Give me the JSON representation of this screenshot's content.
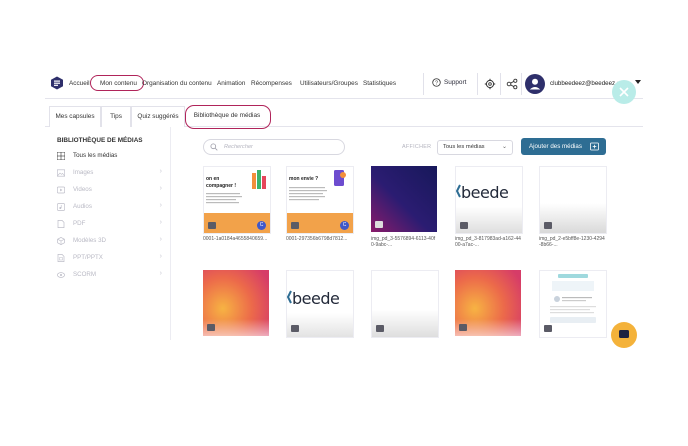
{
  "nav": {
    "items": [
      "Accueil",
      "Mon contenu",
      "Organisation du contenu",
      "Animation",
      "Récompenses",
      "Utilisateurs/Groupes",
      "Statistiques"
    ],
    "support": "Support",
    "username": "clubbeedeez@beedeez.c"
  },
  "tabs": [
    "Mes capsules",
    "Tips",
    "Quiz suggérés",
    "Bibliothèque de médias"
  ],
  "sidebar": {
    "title": "BIBLIOTHÈQUE DE MÉDIAS",
    "items": [
      {
        "label": "Tous les médias",
        "icon": "grid-icon"
      },
      {
        "label": "Images",
        "icon": "image-icon"
      },
      {
        "label": "Videos",
        "icon": "video-icon"
      },
      {
        "label": "Audios",
        "icon": "audio-icon"
      },
      {
        "label": "PDF",
        "icon": "pdf-icon"
      },
      {
        "label": "Modèles 3D",
        "icon": "cube-icon"
      },
      {
        "label": "PPT/PPTX",
        "icon": "presentation-icon"
      },
      {
        "label": "SCORM",
        "icon": "scorm-icon"
      }
    ]
  },
  "toolbar": {
    "search_placeholder": "Rechercher",
    "afficher": "AFFICHER",
    "filter_value": "Tous les médias",
    "add_label": "Ajouter des médias"
  },
  "media": [
    {
      "caption": "0001-1a0184a4655840659...",
      "kind": "slide1"
    },
    {
      "caption": "0001-297356b6798d7812...",
      "kind": "slide2"
    },
    {
      "caption": "img_pd_3-5576894-6113-40f0-9abc-...",
      "kind": "dark"
    },
    {
      "caption": "img_pd_3-817983ad-a162-4400-a7ac-...",
      "kind": "beede"
    },
    {
      "caption": "img_pd_2-e5bff8e-1230-4294-8b66-...",
      "kind": "white"
    },
    {
      "caption": "",
      "kind": "orange"
    },
    {
      "caption": "",
      "kind": "beede"
    },
    {
      "caption": "",
      "kind": "white"
    },
    {
      "caption": "",
      "kind": "orange"
    },
    {
      "caption": "",
      "kind": "phone"
    }
  ],
  "thumb_text": {
    "slide1_a": "on en",
    "slide1_b": "compagner !",
    "slide2_a": "mon envie ?",
    "beede": "beede",
    "c_badge": "C"
  },
  "colors": {
    "accent": "#b0245a",
    "primary": "#2e6d93",
    "avatar": "#2e2f6b"
  }
}
